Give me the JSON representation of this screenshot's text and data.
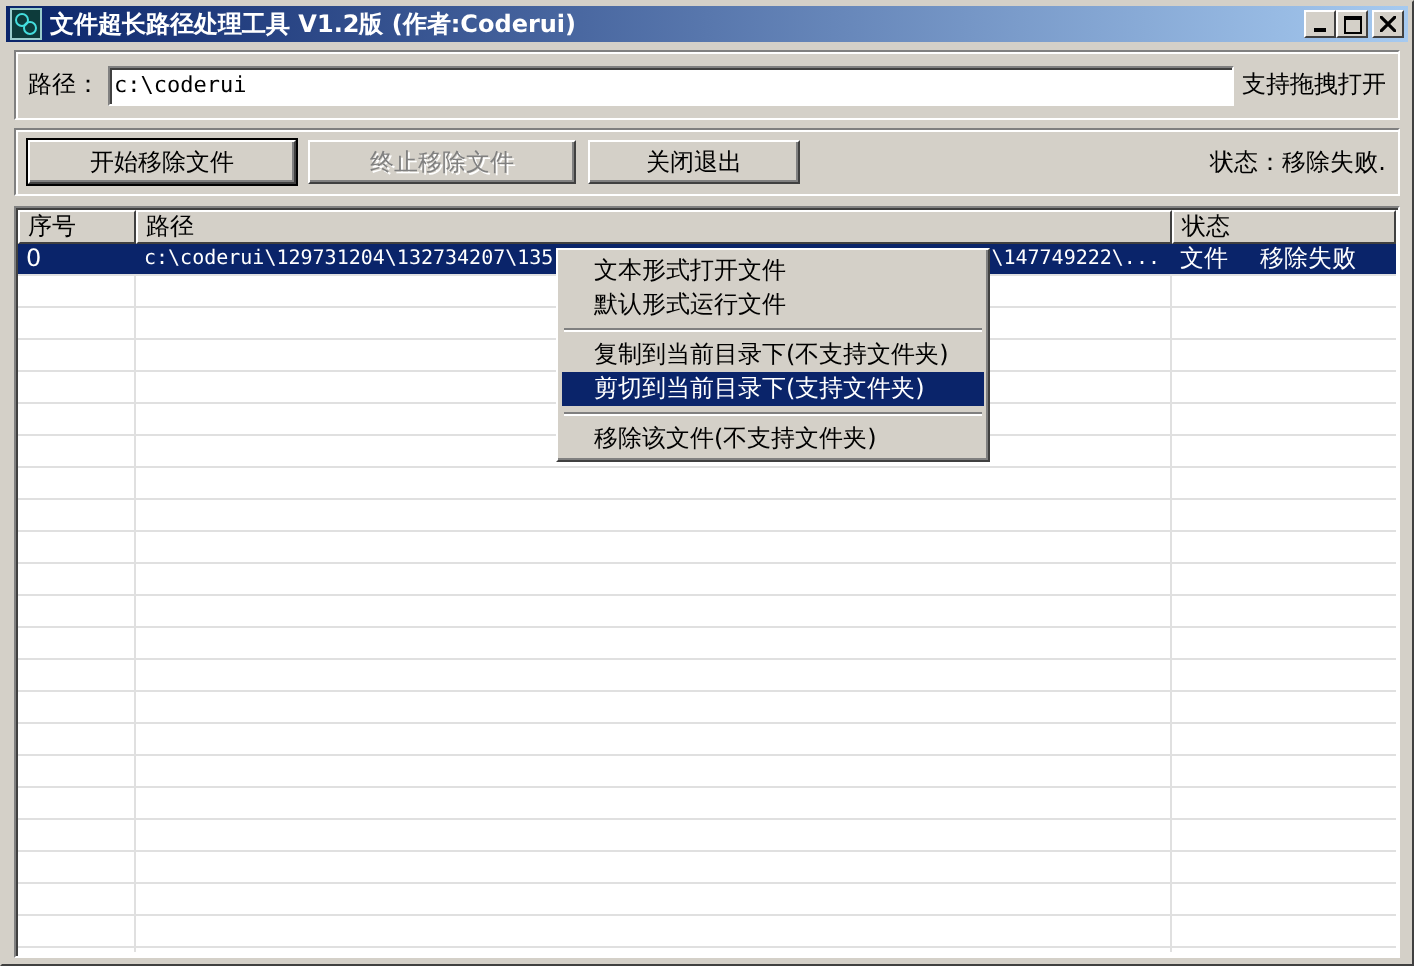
{
  "window": {
    "title": "文件超长路径处理工具 V1.2版 (作者:Coderui)"
  },
  "path_field": {
    "label": "路径：",
    "value": "c:\\coderui",
    "hint": "支持拖拽打开"
  },
  "buttons": [
    {
      "label": "开始移除文件",
      "disabled": false,
      "default": true
    },
    {
      "label": "终止移除文件",
      "disabled": true,
      "default": false
    },
    {
      "label": "关闭退出",
      "disabled": false,
      "default": false
    }
  ],
  "status": "状态：移除失败.",
  "table": {
    "columns": [
      "序号",
      "路径",
      "状态"
    ],
    "rows": [
      {
        "index": "0",
        "path": "c:\\coderui\\129731204\\132734207\\135",
        "path_tail": "\\147749222\\...",
        "type": "文件",
        "status": "移除失败",
        "selected": true
      }
    ]
  },
  "context_menu": {
    "items": [
      {
        "kind": "item",
        "label": "文本形式打开文件",
        "selected": false
      },
      {
        "kind": "item",
        "label": "默认形式运行文件",
        "selected": false
      },
      {
        "kind": "separator"
      },
      {
        "kind": "item",
        "label": "复制到当前目录下(不支持文件夹)",
        "selected": false
      },
      {
        "kind": "item",
        "label": "剪切到当前目录下(支持文件夹)",
        "selected": true
      },
      {
        "kind": "separator"
      },
      {
        "kind": "item",
        "label": "移除该文件(不支持文件夹)",
        "selected": false
      }
    ]
  }
}
